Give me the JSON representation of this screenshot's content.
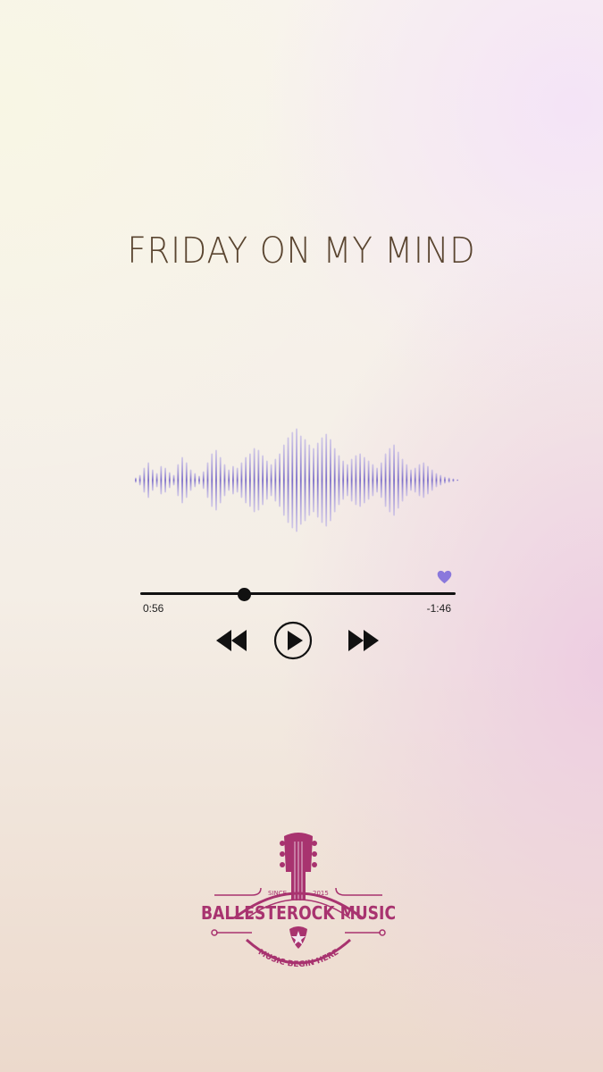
{
  "song": {
    "title": "FRIDAY ON MY MIND"
  },
  "player": {
    "elapsed": "0:56",
    "remaining": "-1:46",
    "progress_fraction": 0.33,
    "favorite": true,
    "controls": {
      "rewind_icon": "rewind-icon",
      "play_icon": "play-icon",
      "forward_icon": "fast-forward-icon"
    }
  },
  "colors": {
    "waveform": "#8c7fd0",
    "heart": "#8a78dc",
    "title": "#5a4530",
    "logo": "#a8336f"
  },
  "logo": {
    "since_label": "SINCE",
    "year": "2015",
    "brand": "BALLESTEROCK MUSIC",
    "tagline": "MUSIC BEGIN HERE"
  }
}
